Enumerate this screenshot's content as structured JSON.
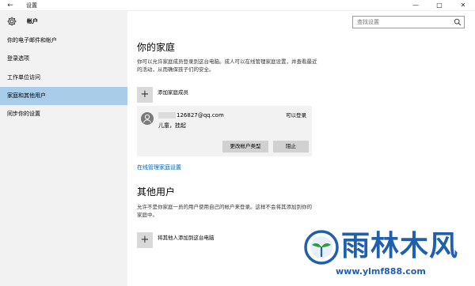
{
  "window": {
    "title": "设置",
    "back_icon": "←",
    "controls": {
      "minimize": "—",
      "maximize": "□",
      "close": "✕"
    }
  },
  "sidebar": {
    "title": "帐户",
    "items": [
      {
        "label": "你的电子邮件和帐户",
        "active": false
      },
      {
        "label": "登录选项",
        "active": false
      },
      {
        "label": "工作单位访问",
        "active": false
      },
      {
        "label": "家庭和其他用户",
        "active": true
      },
      {
        "label": "同步你的设置",
        "active": false
      }
    ]
  },
  "search": {
    "placeholder": "查找设置",
    "icon": "search-icon"
  },
  "family": {
    "heading": "你的家庭",
    "description": "你可以允许家庭成员登录到这台电脑。成人可以在线管理家庭设置，并查看最近的活动，从而确保孩子们的安全。",
    "add_label": "添加家庭成员",
    "member": {
      "email": "126827@qq.com",
      "status": "可以登录",
      "role": "儿童，挂起",
      "change_type_button": "更改帐户类型",
      "block_button": "阻止"
    },
    "manage_link": "在线管理家庭设置"
  },
  "others": {
    "heading": "其他用户",
    "description": "允许不是你家庭一员的用户使用自己的帐户来登录。这样不会将其添加到你的家庭中。",
    "add_label": "将其他人添加到这台电脑"
  },
  "watermark": {
    "text": "雨林木风",
    "url": "www.ylmf888.com"
  },
  "colors": {
    "accent": "#0063b1",
    "nav_active": "#a8cdea",
    "sidebar_bg": "#f2f2f2",
    "watermark": "#1f5fae"
  }
}
